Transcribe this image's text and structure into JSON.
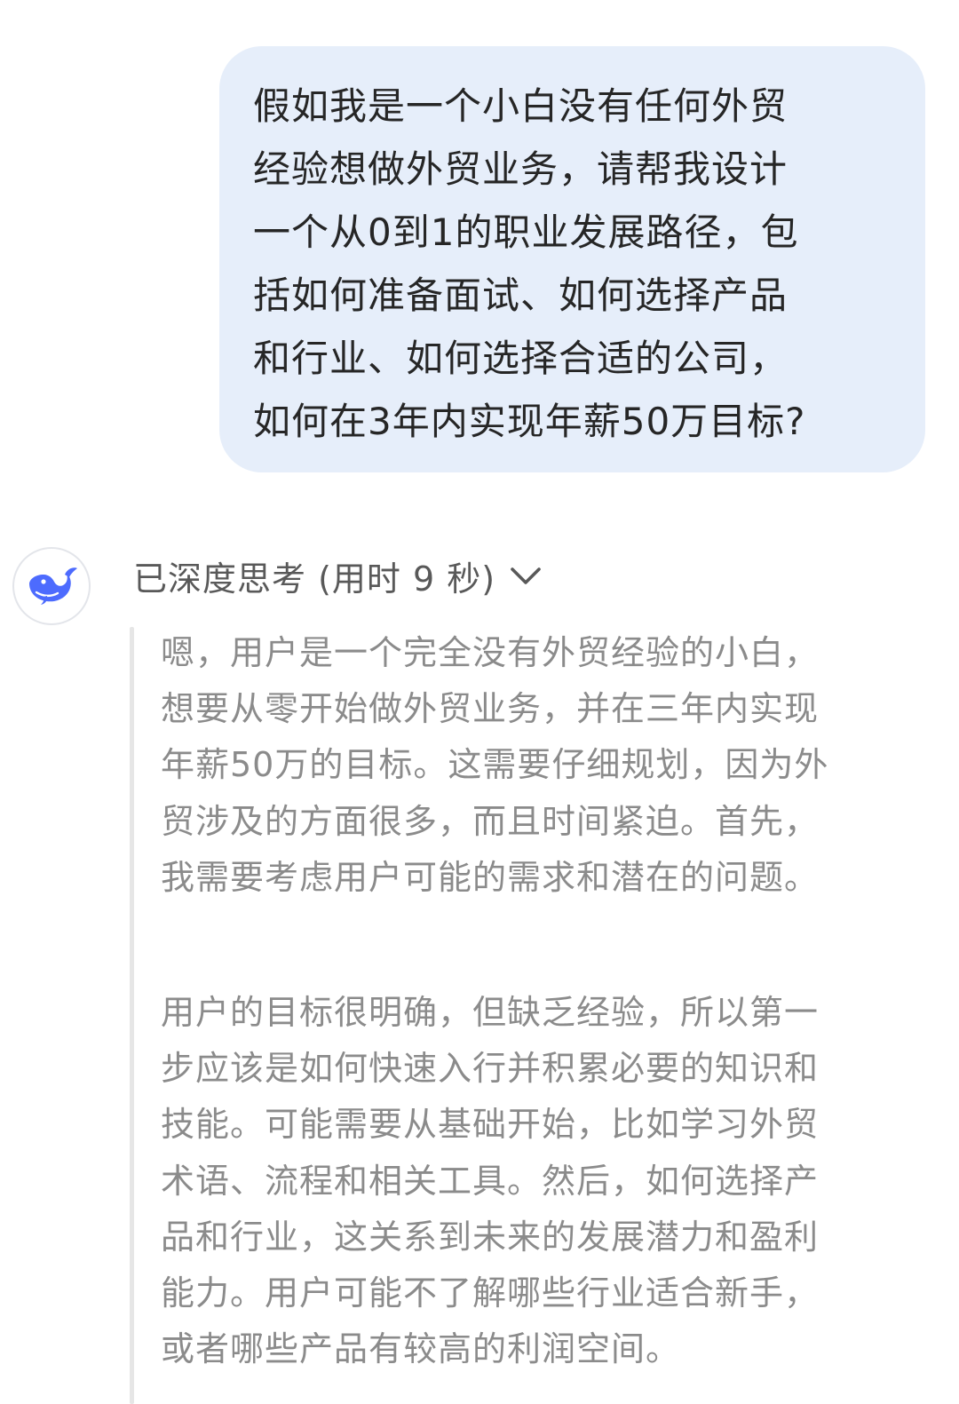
{
  "user_message": {
    "lines": [
      "假如我是一个小白没有任何外贸",
      "经验想做外贸业务，请帮我设计",
      "一个从0到1的职业发展路径，包",
      "括如何准备面试、如何选择产品",
      "和行业、如何选择合适的公司，",
      "如何在3年内实现年薪50万目标?"
    ]
  },
  "assistant": {
    "avatar_icon": "whale-logo-icon",
    "accent_color": "#4d6bfe",
    "thinking_header": "已深度思考 (用时 9 秒)",
    "paragraphs": [
      {
        "lines": [
          "嗯，用户是一个完全没有外贸经验的小白，",
          "想要从零开始做外贸业务，并在三年内实现",
          "年薪50万的目标。这需要仔细规划，因为外",
          "贸涉及的方面很多，而且时间紧迫。首先，",
          "我需要考虑用户可能的需求和潜在的问题。"
        ]
      },
      {
        "lines": [
          "用户的目标很明确，但缺乏经验，所以第一",
          "步应该是如何快速入行并积累必要的知识和",
          "技能。可能需要从基础开始，比如学习外贸",
          "术语、流程和相关工具。然后，如何选择产",
          "品和行业，这关系到未来的发展潜力和盈利",
          "能力。用户可能不了解哪些行业适合新手，",
          "或者哪些产品有较高的利润空间。"
        ]
      }
    ]
  }
}
